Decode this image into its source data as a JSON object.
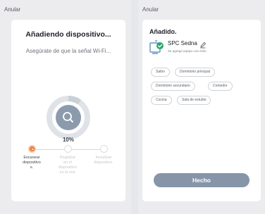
{
  "left_screen": {
    "cancel_label": "Anular",
    "title": "Añadiendo dispositivo...",
    "subtitle": "Asegúrate de que la señal Wi-Fi...",
    "progress_text": "10%",
    "progress_value": 0.1,
    "steps": [
      {
        "label": "Escanear dispositivos.",
        "state": "active"
      },
      {
        "label": "Registrar en el dispositivo en la red.",
        "state": "inactive"
      },
      {
        "label": "Inicializar dispositivo.",
        "state": "inactive"
      }
    ],
    "colors": {
      "accent": "#ee7d3b",
      "ring": "#dfe3e8",
      "center": "#8c9aad"
    }
  },
  "right_screen": {
    "cancel_label": "Anular",
    "title": "Añadido.",
    "device_name": "SPC Sedna",
    "device_status": "Se agregó equipo con éxito",
    "rooms": [
      "Salón",
      "Dormitorio principal",
      "Dormitorio secundario",
      "Comedor",
      "Cocina",
      "Sala de estudio"
    ],
    "done_label": "Hecho",
    "colors": {
      "success": "#27a76b",
      "button": "#8695a8"
    }
  }
}
